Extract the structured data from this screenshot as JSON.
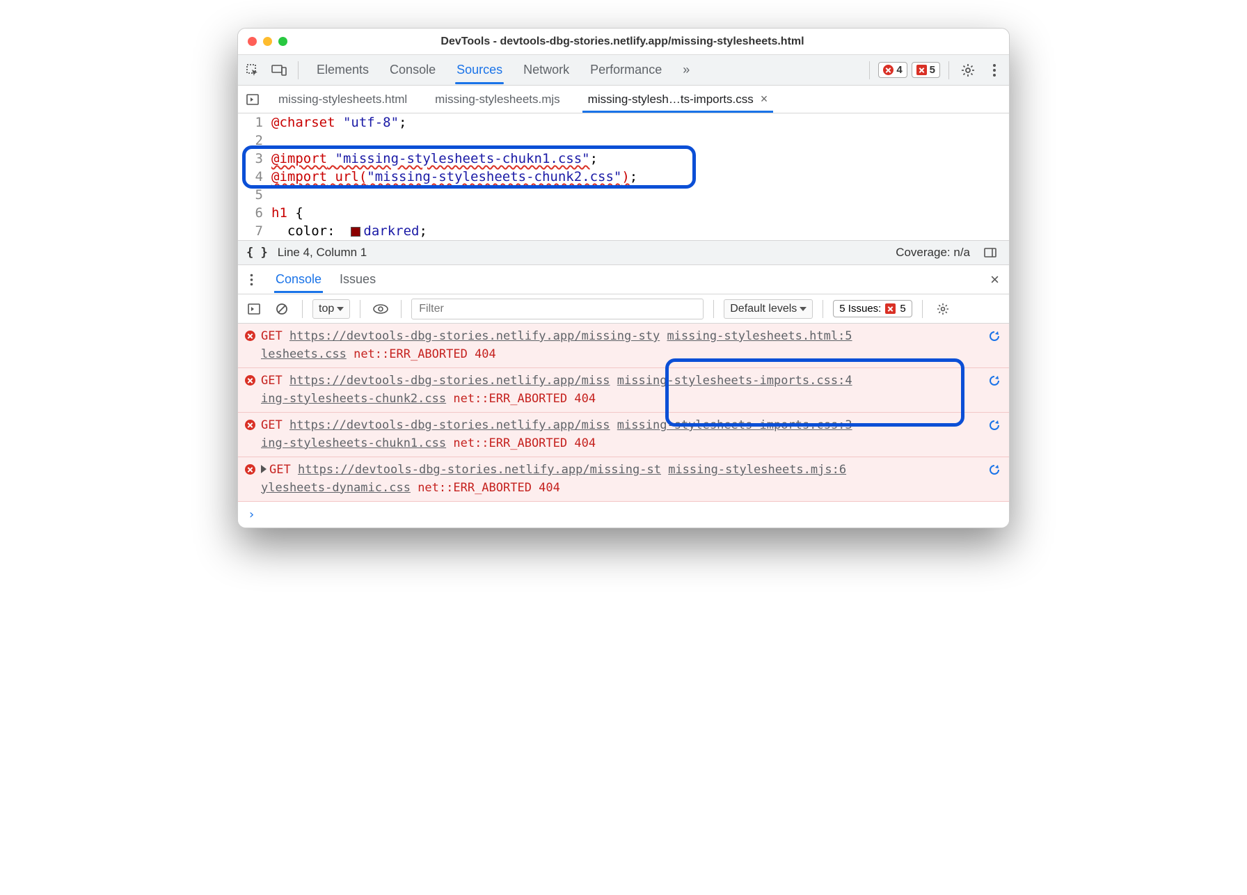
{
  "title": "DevTools - devtools-dbg-stories.netlify.app/missing-stylesheets.html",
  "panels": [
    "Elements",
    "Console",
    "Sources",
    "Network",
    "Performance"
  ],
  "active_panel": "Sources",
  "more": "»",
  "error_count": "4",
  "issue_count": "5",
  "file_tabs": {
    "t0": "missing-stylesheets.html",
    "t1": "missing-stylesheets.mjs",
    "t2": "missing-stylesh…ts-imports.css"
  },
  "active_file": 2,
  "code": {
    "l1": {
      "n": "1",
      "a": "@charset",
      "s": "\"utf-8\"",
      "t": ";"
    },
    "l2": {
      "n": "2"
    },
    "l3": {
      "n": "3",
      "a": "@import",
      "s": "\"missing-stylesheets-chukn1.css\"",
      "t": ";"
    },
    "l4": {
      "n": "4",
      "a": "@import",
      "u": "url(",
      "s": "\"missing-stylesheets-chunk2.css\"",
      "c": ")",
      "t": ";"
    },
    "l5": {
      "n": "5"
    },
    "l6": {
      "n": "6",
      "sel": "h1",
      "br": " {"
    },
    "l7": {
      "n": "7",
      "prop": "  color",
      "colon": ":",
      "val": "darkred",
      "t": ";"
    }
  },
  "status": {
    "cursor": "Line 4, Column 1",
    "coverage": "Coverage: n/a"
  },
  "drawer": {
    "tabs": {
      "console": "Console",
      "issues": "Issues"
    }
  },
  "console_tools": {
    "context": "top",
    "filter_ph": "Filter",
    "levels": "Default levels",
    "issues_label": "5 Issues:",
    "issues_count": "5"
  },
  "messages": {
    "m0": {
      "verb": "GET",
      "url_a": "https://devtools-dbg-stories.netlify.app/missing-sty",
      "url_b": "lesheets.css",
      "err": "net::ERR_ABORTED 404",
      "src": "missing-stylesheets.html:5"
    },
    "m1": {
      "verb": "GET",
      "url_a": "https://devtools-dbg-stories.netlify.app/miss",
      "url_b": "ing-stylesheets-chunk2.css",
      "err": "net::ERR_ABORTED 404",
      "src": "missing-stylesheets-imports.css:4"
    },
    "m2": {
      "verb": "GET",
      "url_a": "https://devtools-dbg-stories.netlify.app/miss",
      "url_b": "ing-stylesheets-chukn1.css",
      "err": "net::ERR_ABORTED 404",
      "src": "missing-stylesheets-imports.css:3"
    },
    "m3": {
      "verb": "GET",
      "url_a": "https://devtools-dbg-stories.netlify.app/missing-st",
      "url_b": "ylesheets-dynamic.css",
      "err": "net::ERR_ABORTED 404",
      "src": "missing-stylesheets.mjs:6"
    }
  },
  "prompt": "›"
}
